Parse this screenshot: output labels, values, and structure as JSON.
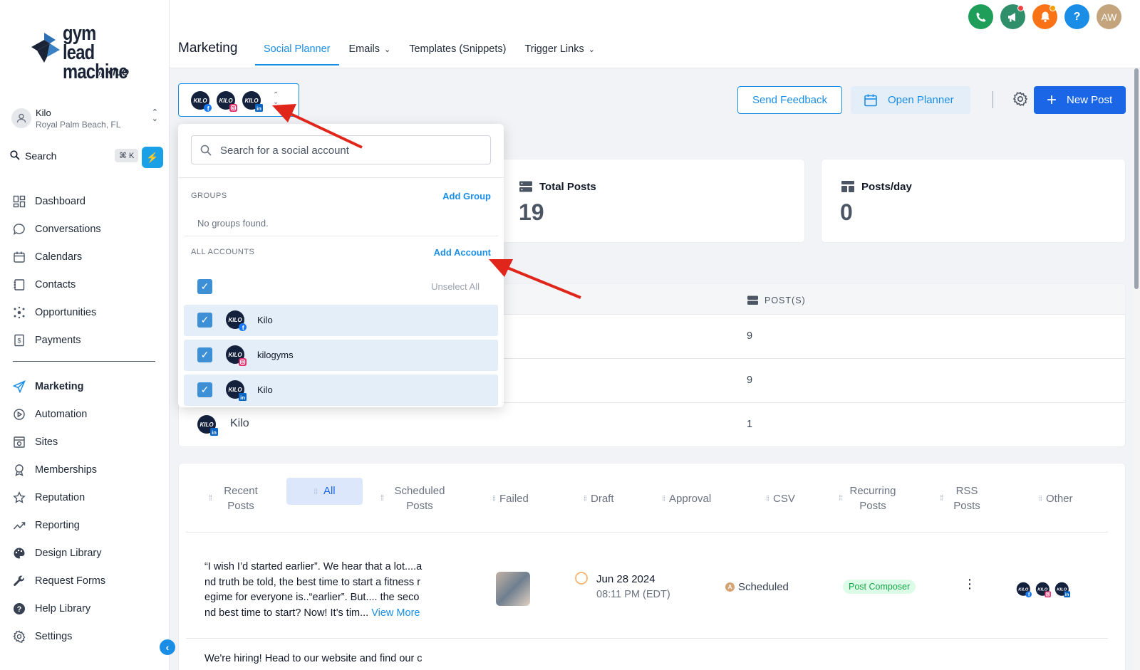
{
  "brand": {
    "logo_line1": "gym lead",
    "logo_line2": "machine",
    "by_label": "by",
    "by_brand": "KILO"
  },
  "account": {
    "name": "Kilo",
    "location": "Royal Palm Beach, FL"
  },
  "search": {
    "label": "Search",
    "shortcut": "⌘ K"
  },
  "sidebar": {
    "items": [
      {
        "label": "Dashboard",
        "icon": "dashboard-icon"
      },
      {
        "label": "Conversations",
        "icon": "chat-icon"
      },
      {
        "label": "Calendars",
        "icon": "calendar-icon"
      },
      {
        "label": "Contacts",
        "icon": "contacts-icon"
      },
      {
        "label": "Opportunities",
        "icon": "opportunities-icon"
      },
      {
        "label": "Payments",
        "icon": "payments-icon"
      }
    ],
    "items2": [
      {
        "label": "Marketing",
        "icon": "send-icon"
      },
      {
        "label": "Automation",
        "icon": "automation-icon"
      },
      {
        "label": "Sites",
        "icon": "sites-icon"
      },
      {
        "label": "Memberships",
        "icon": "memberships-icon"
      },
      {
        "label": "Reputation",
        "icon": "star-icon"
      },
      {
        "label": "Reporting",
        "icon": "reporting-icon"
      },
      {
        "label": "Design Library",
        "icon": "palette-icon"
      },
      {
        "label": "Request Forms",
        "icon": "wrench-icon"
      },
      {
        "label": "Help Library",
        "icon": "help-icon"
      },
      {
        "label": "Settings",
        "icon": "gear-icon"
      }
    ]
  },
  "header": {
    "title": "Marketing",
    "tabs": [
      {
        "label": "Social Planner"
      },
      {
        "label": "Emails"
      },
      {
        "label": "Templates (Snippets)"
      },
      {
        "label": "Trigger Links"
      }
    ],
    "user_initials": "AW",
    "help_glyph": "?",
    "colors": {
      "phone": "#1e9e58",
      "megaphone": "#2f8f6a",
      "bell": "#f97316",
      "help": "#1a8ee6",
      "avatar": "#c4a47c"
    }
  },
  "actions": {
    "send_feedback": "Send Feedback",
    "open_planner": "Open Planner",
    "new_post": "New Post"
  },
  "stats": [
    {
      "label": "Total Posts",
      "value": "19"
    },
    {
      "label": "Posts/day",
      "value": "0"
    }
  ],
  "accounts_table": {
    "posts_header": "POST(S)",
    "rows": [
      {
        "name": "",
        "count": "9",
        "network": "facebook"
      },
      {
        "name": "",
        "count": "9",
        "network": "instagram"
      },
      {
        "name": "Kilo",
        "count": "1",
        "network": "linkedin"
      }
    ]
  },
  "post_tabs": [
    {
      "label": "Recent Posts"
    },
    {
      "label": "All"
    },
    {
      "label": "Scheduled Posts"
    },
    {
      "label": "Failed"
    },
    {
      "label": "Draft"
    },
    {
      "label": "Approval"
    },
    {
      "label": "CSV"
    },
    {
      "label": "Recurring Posts"
    },
    {
      "label": "RSS Posts"
    },
    {
      "label": "Other"
    }
  ],
  "posts": [
    {
      "text_lines": [
        "“I wish I’d started earlier”. We hear that a lot....a",
        "nd truth be told, the best time to start a fitness r",
        "egime for everyone is..“earlier”.  But.... the seco",
        "nd best time to start? Now! It’s tim... "
      ],
      "view_more": "View More",
      "date": "Jun 28 2024",
      "time": "08:11 PM (EDT)",
      "status": "Scheduled",
      "status_initial": "A",
      "source": "Post Composer"
    },
    {
      "text_lines": [
        "We're hiring! Head to our website and find our c"
      ]
    }
  ],
  "dropdown": {
    "search_placeholder": "Search for a social account",
    "groups_label": "GROUPS",
    "add_group": "Add Group",
    "no_groups": "No groups found.",
    "all_accounts_label": "ALL ACCOUNTS",
    "add_account": "Add Account",
    "unselect_all": "Unselect All",
    "accounts": [
      {
        "name": "Kilo",
        "network": "facebook"
      },
      {
        "name": "kilogyms",
        "network": "instagram"
      },
      {
        "name": "Kilo",
        "network": "linkedin"
      }
    ]
  }
}
